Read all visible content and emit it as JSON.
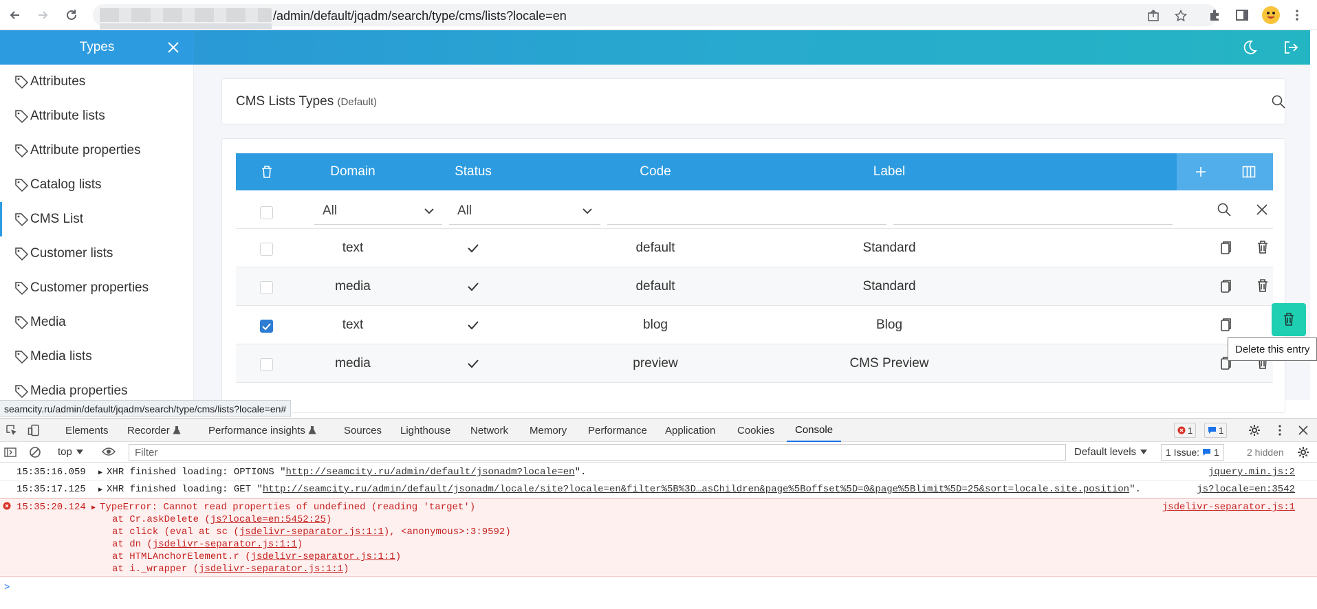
{
  "browser": {
    "url": "/admin/default/jqadm/search/type/cms/lists?locale=en"
  },
  "header": {
    "sidebar_title": "Types"
  },
  "sidebar": {
    "items": [
      {
        "label": "Attributes"
      },
      {
        "label": "Attribute lists"
      },
      {
        "label": "Attribute properties"
      },
      {
        "label": "Catalog lists"
      },
      {
        "label": "CMS List",
        "active": true
      },
      {
        "label": "Customer lists"
      },
      {
        "label": "Customer properties"
      },
      {
        "label": "Media"
      },
      {
        "label": "Media lists"
      },
      {
        "label": "Media properties"
      }
    ]
  },
  "page": {
    "title": "CMS Lists Types",
    "site": "(Default)"
  },
  "table": {
    "columns": [
      "Domain",
      "Status",
      "Code",
      "Label"
    ],
    "filters": {
      "domain": "All",
      "status": "All"
    },
    "rows": [
      {
        "domain": "text",
        "status": true,
        "code": "default",
        "label": "Standard",
        "checked": false
      },
      {
        "domain": "media",
        "status": true,
        "code": "default",
        "label": "Standard",
        "checked": false
      },
      {
        "domain": "text",
        "status": true,
        "code": "blog",
        "label": "Blog",
        "checked": true
      },
      {
        "domain": "media",
        "status": true,
        "code": "preview",
        "label": "CMS Preview",
        "checked": false
      }
    ],
    "tooltip": "Delete this entry"
  },
  "statusbar": {
    "url": "seamcity.ru/admin/default/jqadm/search/type/cms/lists?locale=en#"
  },
  "devtools": {
    "tabs": [
      "Elements",
      "Recorder",
      "Performance insights",
      "Sources",
      "Lighthouse",
      "Network",
      "Memory",
      "Performance",
      "Application",
      "Cookies",
      "Console"
    ],
    "active_tab": "Console",
    "error_count": "1",
    "message_count": "1",
    "context": "top",
    "filter_placeholder": "Filter",
    "levels": "Default levels",
    "issues_label": "1 Issue:",
    "issues_count": "1",
    "hidden": "2 hidden",
    "logs": [
      {
        "ts": "15:35:16.059",
        "prefix": "XHR finished loading: OPTIONS \"",
        "url": "http://seamcity.ru/admin/default/jsonadm?locale=en",
        "suffix": "\".",
        "src": "jquery.min.js:2"
      },
      {
        "ts": "15:35:17.125",
        "prefix": "XHR finished loading: GET \"",
        "url": "http://seamcity.ru/admin/default/jsonadm/locale/site?locale=en&filter%5B%3D…asChildren&page%5Boffset%5D=0&page%5Blimit%5D=25&sort=locale.site.position",
        "suffix": "\".",
        "src": "js?locale=en:3542"
      }
    ],
    "error": {
      "ts": "15:35:20.124",
      "message": "TypeError: Cannot read properties of undefined (reading 'target')",
      "src": "jsdelivr-separator.js:1",
      "stack": [
        {
          "pre": "at Cr.askDelete (",
          "link": "js?locale=en:5452:25",
          "post": ")"
        },
        {
          "pre": "at click (eval at sc (",
          "link": "jsdelivr-separator.js:1:1",
          "post": "), <anonymous>:3:9592)"
        },
        {
          "pre": "at dn (",
          "link": "jsdelivr-separator.js:1:1",
          "post": ")"
        },
        {
          "pre": "at HTMLAnchorElement.r (",
          "link": "jsdelivr-separator.js:1:1",
          "post": ")"
        },
        {
          "pre": "at i._wrapper (",
          "link": "jsdelivr-separator.js:1:1",
          "post": ")"
        }
      ]
    },
    "prompt": ">"
  }
}
